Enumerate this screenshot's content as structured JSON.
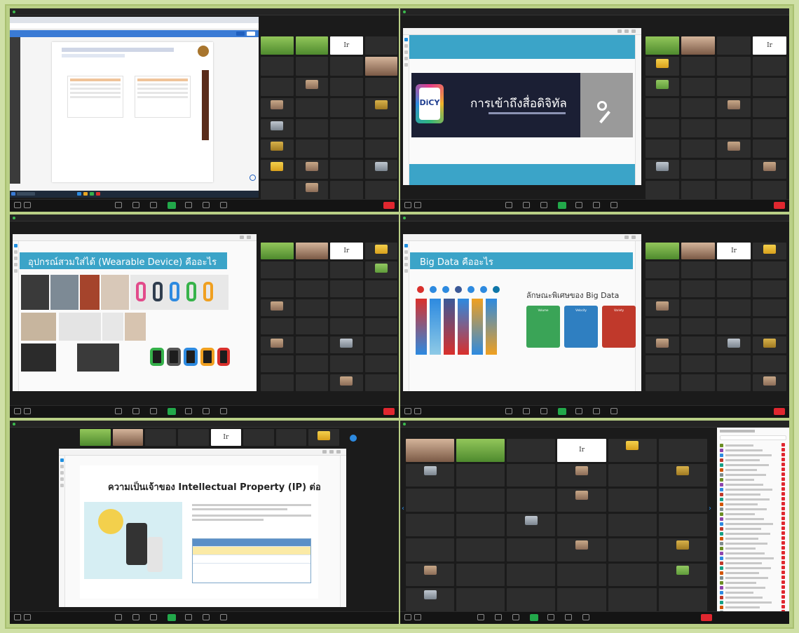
{
  "frame_color": "#b9cf86",
  "screens": {
    "s1": {
      "browser_title": "",
      "doc_heading": "",
      "doc_subheading": "",
      "doc_list_left_title": "",
      "doc_list_left": [],
      "doc_list_right_title": "",
      "doc_list_right": [],
      "vertical_label": "",
      "taskbar_search": ""
    },
    "s2": {
      "slide_title": "การเข้าถึงสื่อดิจิทัล",
      "slide_subtitle": "",
      "logo_text": "DiCY"
    },
    "s3": {
      "slide_title": "อุปกรณ์สวมใส่ได้ (Wearable Device) คืออะไร"
    },
    "s4": {
      "slide_title": "Big Data คืออะไร",
      "section_title": "ลักษณะพิเศษของ Big Data",
      "card_labels": [
        "Volume",
        "Velocity",
        "Variety"
      ],
      "card_colors": [
        "#3aa457",
        "#2f7fc1",
        "#c0392b"
      ]
    },
    "s5": {
      "slide_title": "ความเป็นเจ้าของ Intellectual Property (IP) ต่อ",
      "bullets": [],
      "table": {
        "headers": [],
        "rows": []
      }
    },
    "s6": {
      "panel_title": "",
      "panel_rows": 36
    }
  }
}
